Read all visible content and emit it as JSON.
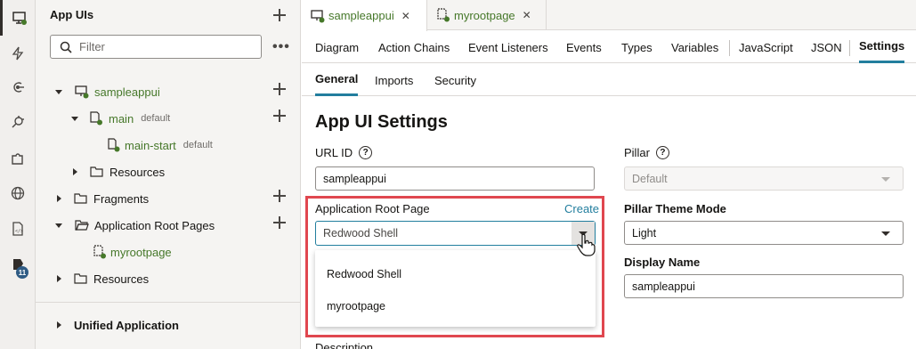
{
  "activity_bar": {
    "items": [
      {
        "name": "app-uis-icon",
        "active": true
      },
      {
        "name": "lightning-icon"
      },
      {
        "name": "services-icon"
      },
      {
        "name": "plug-icon"
      },
      {
        "name": "components-icon"
      },
      {
        "name": "globe-icon"
      },
      {
        "name": "source-file-icon"
      },
      {
        "name": "audit-icon",
        "badge": "11"
      }
    ]
  },
  "navigator": {
    "title": "App UIs",
    "filter_placeholder": "Filter",
    "more_label": "•••",
    "tree": [
      {
        "label": "sampleappui",
        "tag": ""
      },
      {
        "label": "main",
        "tag": "default"
      },
      {
        "label": "main-start",
        "tag": "default"
      },
      {
        "label": "Resources",
        "tag": ""
      },
      {
        "label": "Fragments",
        "tag": ""
      },
      {
        "label": "Application Root Pages",
        "tag": ""
      },
      {
        "label": "myrootpage",
        "tag": ""
      },
      {
        "label": "Resources",
        "tag": ""
      }
    ],
    "unified_application": "Unified Application"
  },
  "file_tabs": [
    {
      "label": "sampleappui",
      "close": "✕"
    },
    {
      "label": "myrootpage",
      "close": "✕"
    }
  ],
  "editor_tabs": [
    "Diagram",
    "Action Chains",
    "Event Listeners",
    "Events",
    "Types",
    "Variables",
    "JavaScript",
    "JSON",
    "Settings"
  ],
  "settings_tabs": [
    "General",
    "Imports",
    "Security"
  ],
  "settings": {
    "heading": "App UI Settings",
    "url_id_label": "URL ID",
    "url_id_value": "sampleappui",
    "pillar_label": "Pillar",
    "pillar_value": "Default",
    "root_page_label": "Application Root Page",
    "create_link": "Create",
    "root_page_value": "Redwood Shell",
    "root_page_options": [
      "Redwood Shell",
      "myrootpage"
    ],
    "pillar_theme_label": "Pillar Theme Mode",
    "pillar_theme_value": "Light",
    "display_name_label": "Display Name",
    "display_name_value": "sampleappui",
    "description_label": "Description"
  },
  "colors": {
    "accent": "#227e9e",
    "highlight": "#e0474f",
    "green": "#46782a"
  }
}
